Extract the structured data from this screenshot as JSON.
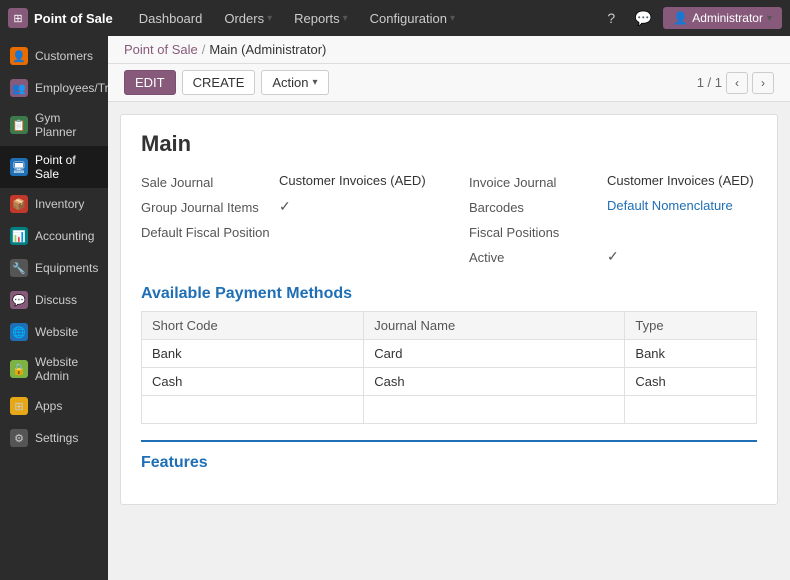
{
  "app": {
    "name": "Point of Sale",
    "logo_icon": "⊞"
  },
  "topnav": {
    "menu_items": [
      {
        "label": "Dashboard",
        "has_dropdown": false
      },
      {
        "label": "Orders",
        "has_dropdown": true
      },
      {
        "label": "Reports",
        "has_dropdown": true
      },
      {
        "label": "Configuration",
        "has_dropdown": true
      }
    ],
    "icons": {
      "help": "?",
      "chat": "💬"
    },
    "user": "Administrator"
  },
  "sidebar": {
    "items": [
      {
        "label": "Customers",
        "icon": "👤",
        "color": "si-orange",
        "active": false
      },
      {
        "label": "Employees/Trainer",
        "icon": "👥",
        "color": "si-purple",
        "active": false
      },
      {
        "label": "Gym Planner",
        "icon": "📋",
        "color": "si-green",
        "active": false
      },
      {
        "label": "Point of Sale",
        "icon": "🖥",
        "color": "si-blue",
        "active": true
      },
      {
        "label": "Inventory",
        "icon": "📦",
        "color": "si-red",
        "active": false
      },
      {
        "label": "Accounting",
        "icon": "📊",
        "color": "si-teal",
        "active": false
      },
      {
        "label": "Equipments",
        "icon": "🔧",
        "color": "si-gray",
        "active": false
      },
      {
        "label": "Discuss",
        "icon": "💬",
        "color": "si-purple",
        "active": false
      },
      {
        "label": "Website",
        "icon": "🌐",
        "color": "si-blue",
        "active": false
      },
      {
        "label": "Website Admin",
        "icon": "🔒",
        "color": "si-lime",
        "active": false
      },
      {
        "label": "Apps",
        "icon": "⊞",
        "color": "si-yellow",
        "active": false
      },
      {
        "label": "Settings",
        "icon": "⚙",
        "color": "si-gray",
        "active": false
      }
    ]
  },
  "breadcrumb": {
    "parent": "Point of Sale",
    "separator": "/",
    "current": "Main (Administrator)"
  },
  "toolbar": {
    "edit_label": "EDIT",
    "create_label": "CREATE",
    "action_label": "Action",
    "pagination": "1 / 1"
  },
  "form": {
    "title": "Main",
    "left": {
      "sale_journal_label": "Sale Journal",
      "sale_journal_value": "Customer Invoices (AED)",
      "group_journal_label": "Group Journal Items",
      "group_journal_check": "✓",
      "default_fiscal_label": "Default Fiscal Position",
      "default_fiscal_value": ""
    },
    "right": {
      "invoice_journal_label": "Invoice Journal",
      "invoice_journal_value": "Customer Invoices (AED)",
      "barcodes_label": "Barcodes",
      "barcodes_value": "Default Nomenclature",
      "fiscal_positions_label": "Fiscal Positions",
      "active_label": "Active",
      "active_check": "✓"
    }
  },
  "payment_methods": {
    "heading": "Available Payment Methods",
    "columns": [
      "Short Code",
      "Journal Name",
      "Type"
    ],
    "rows": [
      {
        "short_code": "Bank",
        "journal_name": "Card",
        "type": "Bank"
      },
      {
        "short_code": "Cash",
        "journal_name": "Cash",
        "type": "Cash"
      }
    ]
  },
  "features": {
    "heading": "Features"
  }
}
